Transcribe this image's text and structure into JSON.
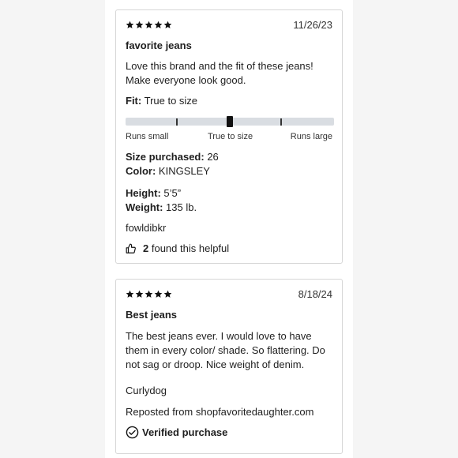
{
  "reviews": [
    {
      "rating": 5,
      "date": "11/26/23",
      "title": "favorite jeans",
      "body": "Love this brand and the fit of these jeans! Make everyone look good.",
      "fit_label": "Fit:",
      "fit_value": "True to size",
      "fit_scale": {
        "left": "Runs small",
        "center": "True to size",
        "right": "Runs large",
        "position": 0.5
      },
      "size_label": "Size purchased:",
      "size_value": "26",
      "color_label": "Color:",
      "color_value": "KINGSLEY",
      "height_label": "Height:",
      "height_value": "5’5”",
      "weight_label": "Weight:",
      "weight_value": "135 lb.",
      "author": "fowldibkr",
      "helpful_count": "2",
      "helpful_text": "found this helpful"
    },
    {
      "rating": 5,
      "date": "8/18/24",
      "title": "Best jeans",
      "body": "The best jeans ever. I would love to have them in every color/ shade. So flattering. Do not sag or droop.   Nice weight of denim.",
      "author": "Curlydog",
      "repost": "Reposted from shopfavoritedaughter.com",
      "verified": "Verified purchase"
    }
  ],
  "icons": {
    "star": "star-icon",
    "thumbs_up": "thumbs-up-icon",
    "verified": "check-circle-icon"
  },
  "colors": {
    "star": "#111111",
    "track": "#d9dde2",
    "border": "#d6d6d6"
  }
}
